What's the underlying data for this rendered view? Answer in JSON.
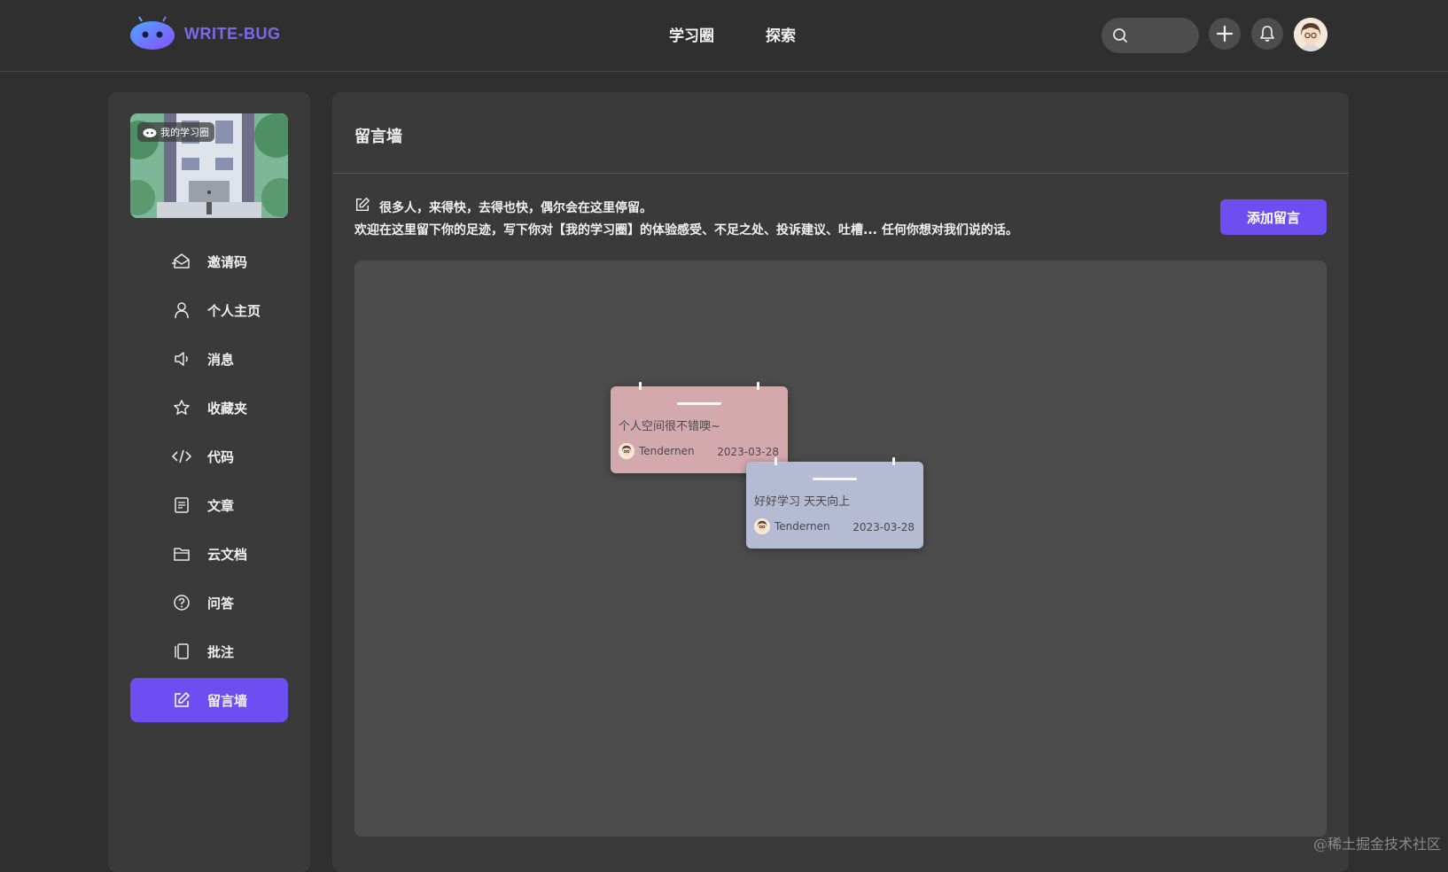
{
  "header": {
    "logo_text": "WRITE-BUG",
    "nav": [
      "学习圈",
      "探索"
    ],
    "search_placeholder": ""
  },
  "sidebar": {
    "banner_label": "我的学习圈",
    "items": [
      {
        "label": "邀请码",
        "icon": "invite-icon"
      },
      {
        "label": "个人主页",
        "icon": "user-icon"
      },
      {
        "label": "消息",
        "icon": "speaker-icon"
      },
      {
        "label": "收藏夹",
        "icon": "star-icon"
      },
      {
        "label": "代码",
        "icon": "code-icon"
      },
      {
        "label": "文章",
        "icon": "document-icon"
      },
      {
        "label": "云文档",
        "icon": "folder-icon"
      },
      {
        "label": "问答",
        "icon": "question-icon"
      },
      {
        "label": "批注",
        "icon": "annotation-icon"
      },
      {
        "label": "留言墙",
        "icon": "edit-icon",
        "active": true
      }
    ]
  },
  "main": {
    "title": "留言墙",
    "intro_line1": "很多人，来得快，去得也快，偶尔会在这里停留。",
    "intro_line2": "欢迎在这里留下你的足迹，写下你对【我的学习圈】的体验感受、不足之处、投诉建议、吐槽... 任何你想对我们说的话。",
    "add_button": "添加留言",
    "notes": [
      {
        "text": "个人空间很不错噢~",
        "user": "Tendernen",
        "date": "2023-03-28",
        "color": "#d4a9ae"
      },
      {
        "text": "好好学习 天天向上",
        "user": "Tendernen",
        "date": "2023-03-28",
        "color": "#b4bbd3"
      }
    ]
  },
  "watermark": "@稀土掘金技术社区",
  "colors": {
    "accent": "#6c4ff0",
    "background": "#2f2f2f",
    "panel": "#3a3a3a",
    "board": "#4c4c4c"
  }
}
